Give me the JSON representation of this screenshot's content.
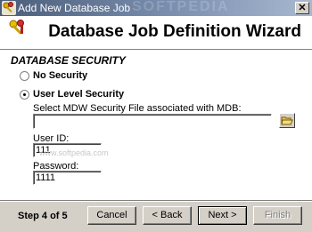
{
  "window": {
    "title": "Add New Database Job",
    "watermark": "SOFTPEDIA"
  },
  "header": {
    "title": "Database Job Definition Wizard"
  },
  "content": {
    "section_title": "DATABASE SECURITY",
    "options": [
      {
        "label": "No Security",
        "selected": false
      },
      {
        "label": "User Level Security",
        "selected": true
      }
    ],
    "mdw_label": "Select MDW Security File associated with MDB:",
    "mdw_value": "",
    "user_id_label": "User ID:",
    "user_id_value": "111",
    "password_label": "Password:",
    "password_value": "1111",
    "watermark_text": "www.softpedia.com"
  },
  "footer": {
    "step_text": "Step 4 of 5",
    "cancel_label": "Cancel",
    "back_label": "< Back",
    "next_label": "Next >",
    "finish_label": "Finish"
  },
  "colors": {
    "title_bar": "#5a6e8e",
    "dialog_face": "#d4d0c8",
    "content_bg": "#ffffff"
  },
  "icons": {
    "title": "keys-icon",
    "header": "keys-icon",
    "browse": "folder-open-icon",
    "close": "close-icon"
  }
}
